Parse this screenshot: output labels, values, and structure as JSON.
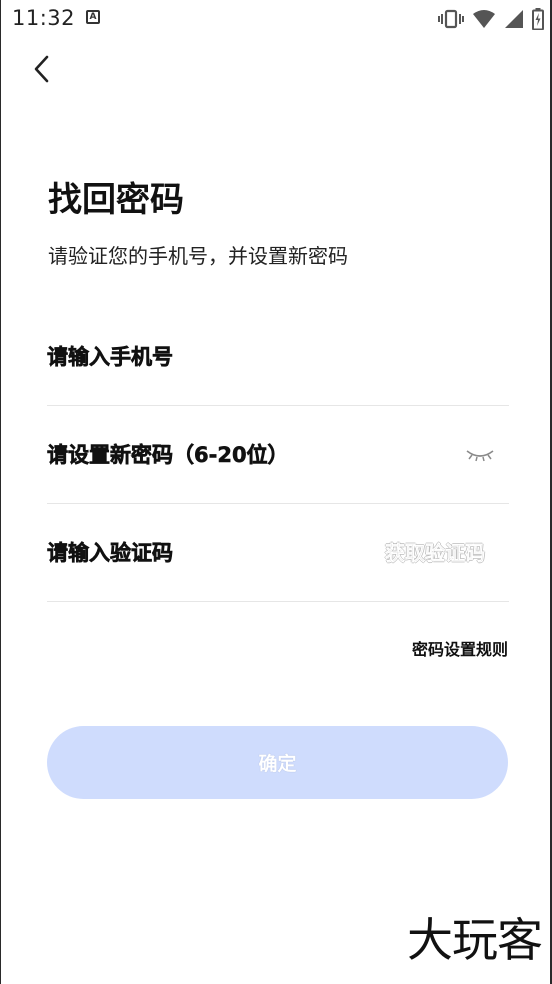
{
  "status_bar": {
    "time": "11:32",
    "notification_icon": "text-a-icon",
    "right_icons": [
      "vibrate-icon",
      "wifi-icon",
      "signal-icon",
      "battery-icon"
    ]
  },
  "header": {
    "back_icon": "chevron-left-icon"
  },
  "page": {
    "title": "找回密码",
    "subtitle": "请验证您的手机号，并设置新密码"
  },
  "form": {
    "phone_placeholder": "请输入手机号",
    "phone_value": "",
    "password_placeholder": "请设置新密码（6-20位）",
    "password_value": "",
    "password_toggle_icon": "eye-closed-icon",
    "code_placeholder": "请输入验证码",
    "code_value": "",
    "get_code_label": "获取验证码"
  },
  "rules_link": "密码设置规则",
  "confirm_button": "确定",
  "watermark": "大玩客",
  "colors": {
    "button_bg": "#cfdcfd",
    "divider": "#e6e6e6",
    "disabled_text": "#cfcfcf"
  }
}
